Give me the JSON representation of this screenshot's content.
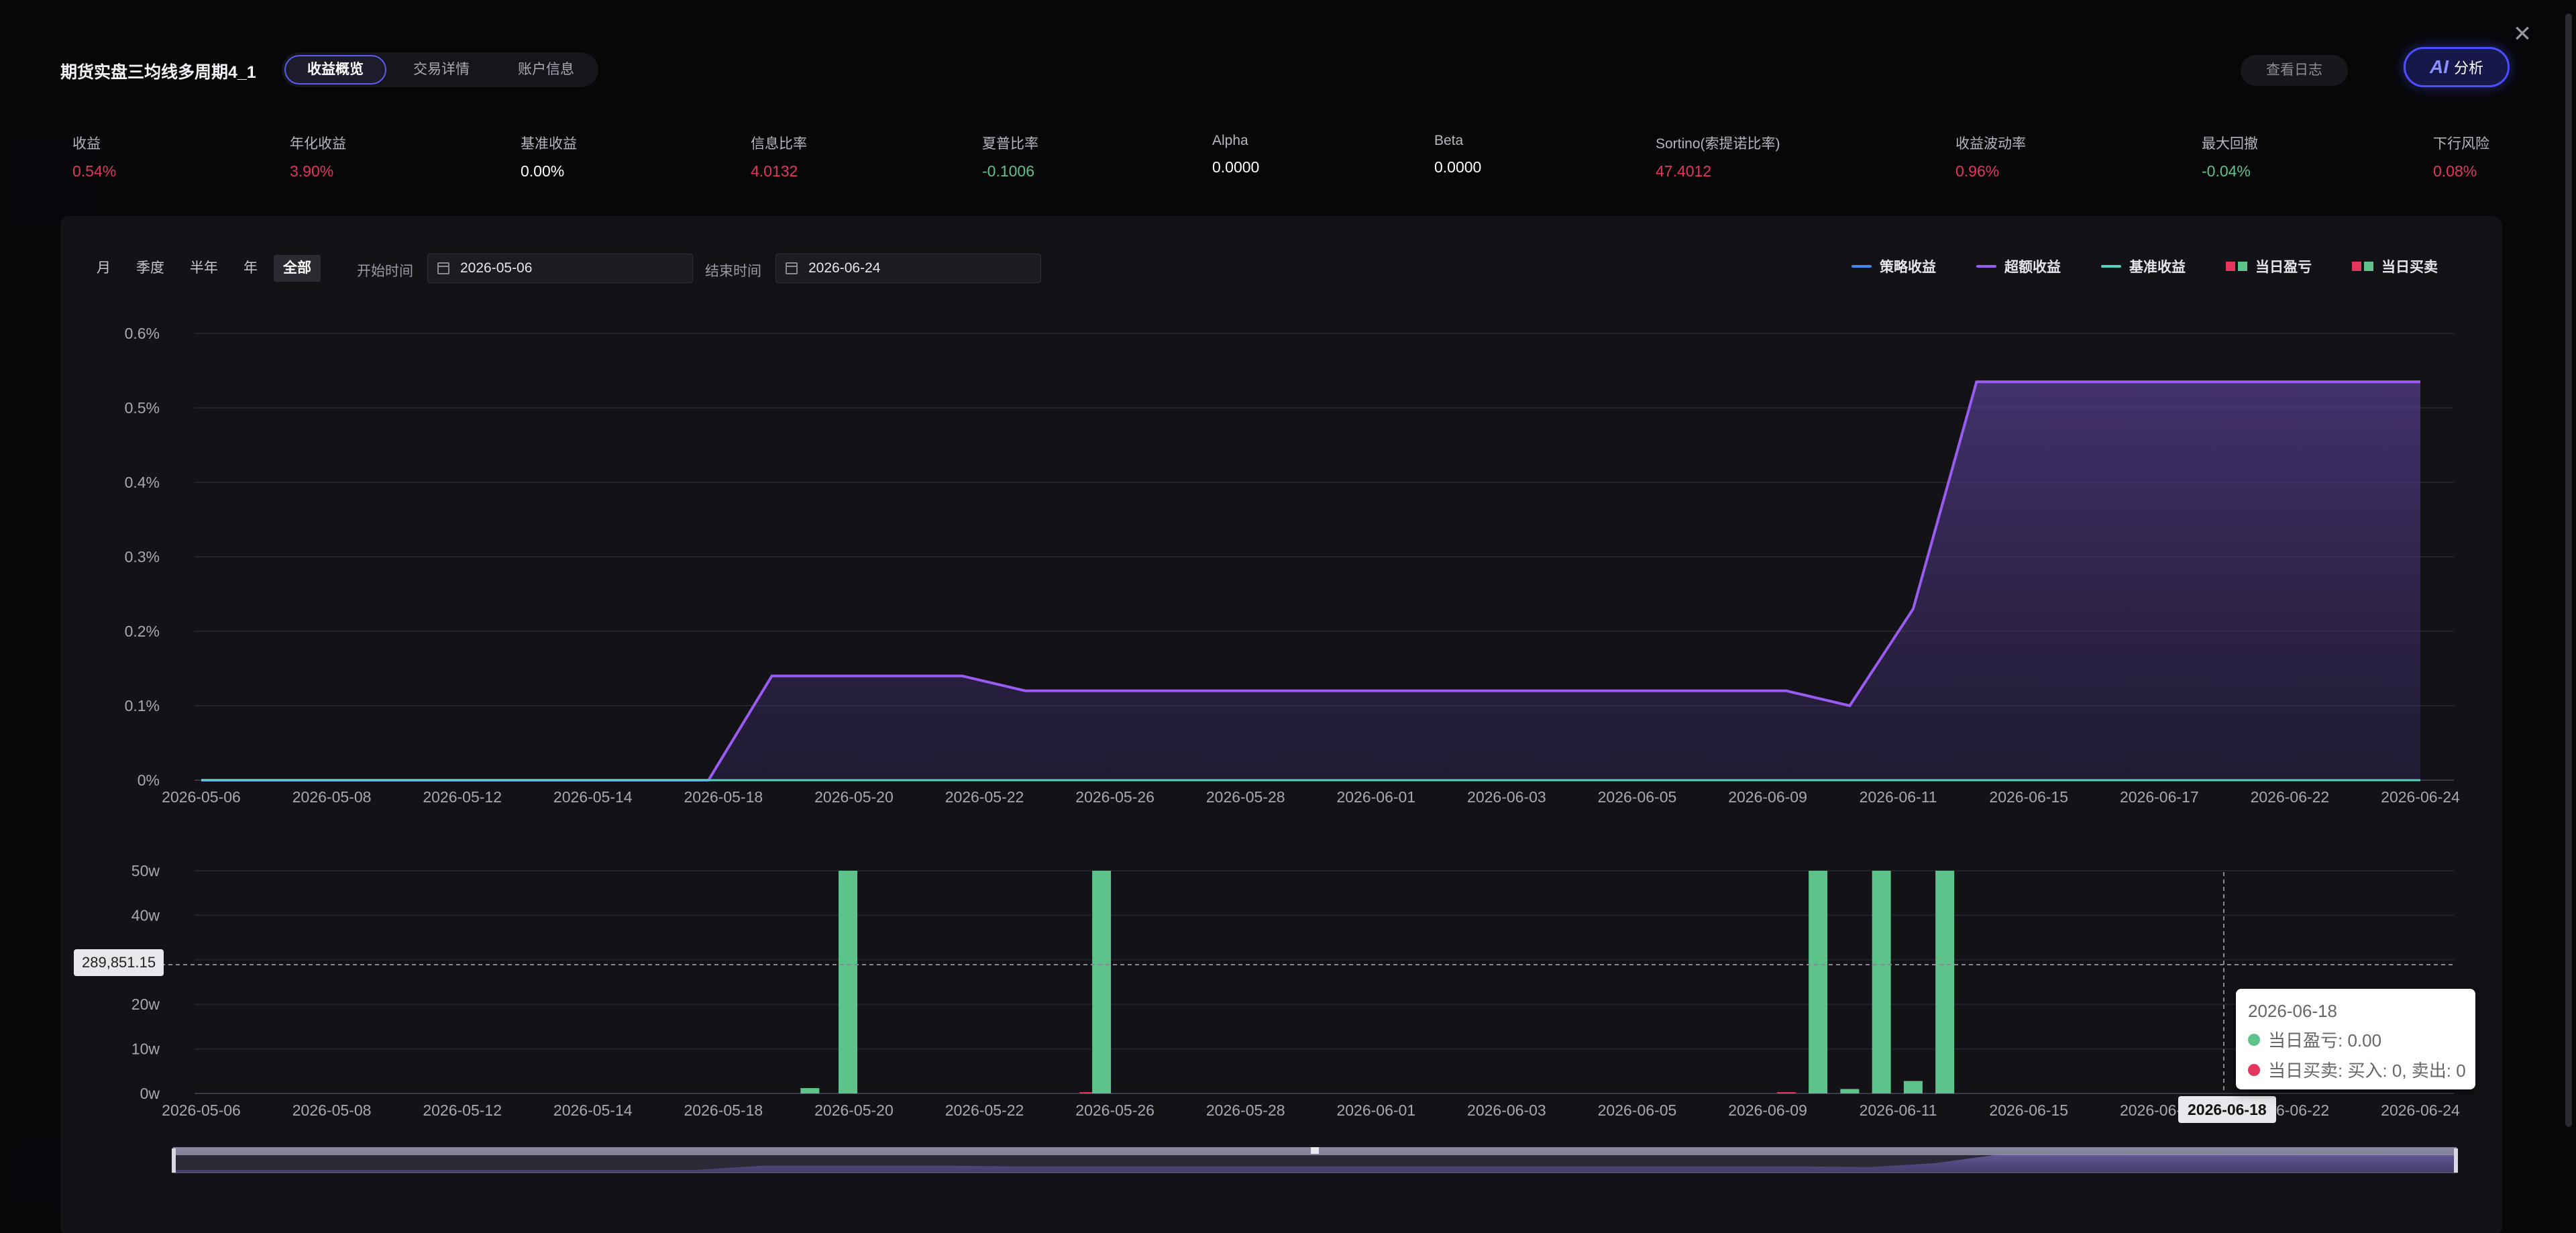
{
  "header": {
    "title": "期货实盘三均线多周期4_1",
    "tabs": [
      {
        "label": "收益概览",
        "active": true
      },
      {
        "label": "交易详情",
        "active": false
      },
      {
        "label": "账户信息",
        "active": false
      }
    ],
    "log_button": "查看日志",
    "ai_button": {
      "icon_text": "AI",
      "label": "分析"
    }
  },
  "metrics": [
    {
      "label": "收益",
      "value": "0.54%",
      "tone": "red"
    },
    {
      "label": "年化收益",
      "value": "3.90%",
      "tone": "red"
    },
    {
      "label": "基准收益",
      "value": "0.00%",
      "tone": "white"
    },
    {
      "label": "信息比率",
      "value": "4.0132",
      "tone": "red"
    },
    {
      "label": "夏普比率",
      "value": "-0.1006",
      "tone": "green"
    },
    {
      "label": "Alpha",
      "value": "0.0000",
      "tone": "white"
    },
    {
      "label": "Beta",
      "value": "0.0000",
      "tone": "white"
    },
    {
      "label": "Sortino(索提诺比率)",
      "value": "47.4012",
      "tone": "red"
    },
    {
      "label": "收益波动率",
      "value": "0.96%",
      "tone": "red"
    },
    {
      "label": "最大回撤",
      "value": "-0.04%",
      "tone": "green"
    },
    {
      "label": "下行风险",
      "value": "0.08%",
      "tone": "red"
    }
  ],
  "controls": {
    "ranges": [
      {
        "label": "月",
        "active": false
      },
      {
        "label": "季度",
        "active": false
      },
      {
        "label": "半年",
        "active": false
      },
      {
        "label": "年",
        "active": false
      },
      {
        "label": "全部",
        "active": true
      }
    ],
    "start_label": "开始时间",
    "start_value": "2026-05-06",
    "end_label": "结束时间",
    "end_value": "2026-06-24"
  },
  "legend": [
    {
      "label": "策略收益",
      "kind": "line",
      "color": "#3d8bf0"
    },
    {
      "label": "超额收益",
      "kind": "line",
      "color": "#9a5cf0"
    },
    {
      "label": "基准收益",
      "kind": "line",
      "color": "#4fd1c1"
    },
    {
      "label": "当日盈亏",
      "kind": "squares",
      "colors": [
        "#e4355c",
        "#5ec38b"
      ]
    },
    {
      "label": "当日买卖",
      "kind": "squares",
      "colors": [
        "#e4355c",
        "#5ec38b"
      ]
    }
  ],
  "chart_data": [
    {
      "type": "area",
      "title": "",
      "xlabel": "",
      "ylabel": "",
      "ylim": [
        0,
        0.6
      ],
      "y_ticks": [
        "0%",
        "0.1%",
        "0.2%",
        "0.3%",
        "0.4%",
        "0.5%",
        "0.6%"
      ],
      "x_ticks": [
        "2026-05-06",
        "2026-05-08",
        "2026-05-12",
        "2026-05-14",
        "2026-05-18",
        "2026-05-20",
        "2026-05-22",
        "2026-05-26",
        "2026-05-28",
        "2026-06-01",
        "2026-06-03",
        "2026-06-05",
        "2026-06-09",
        "2026-06-11",
        "2026-06-15",
        "2026-06-17",
        "2026-06-22",
        "2026-06-24"
      ],
      "series": [
        {
          "name": "超额收益",
          "color": "#9a5cf0",
          "values": [
            0,
            0,
            0,
            0,
            0,
            0,
            0,
            0,
            0,
            0.14,
            0.14,
            0.14,
            0.14,
            0.12,
            0.12,
            0.12,
            0.12,
            0.12,
            0.12,
            0.12,
            0.12,
            0.12,
            0.12,
            0.12,
            0.12,
            0.12,
            0.1,
            0.23,
            0.535,
            0.535,
            0.535,
            0.535,
            0.535,
            0.535,
            0.535,
            0.535
          ]
        },
        {
          "name": "基准收益",
          "color": "#4fd1c1",
          "values": [
            0,
            0,
            0,
            0,
            0,
            0,
            0,
            0,
            0,
            0,
            0,
            0,
            0,
            0,
            0,
            0,
            0,
            0,
            0,
            0,
            0,
            0,
            0,
            0,
            0,
            0,
            0,
            0,
            0,
            0,
            0,
            0,
            0,
            0,
            0,
            0
          ]
        }
      ],
      "grid": true
    },
    {
      "type": "bar",
      "title": "",
      "ylim": [
        0,
        50
      ],
      "y_ticks": [
        "0w",
        "10w",
        "20w",
        "30w",
        "40w",
        "50w"
      ],
      "x_ticks": [
        "2026-05-06",
        "2026-05-08",
        "2026-05-12",
        "2026-05-14",
        "2026-05-18",
        "2026-05-20",
        "2026-05-22",
        "2026-05-26",
        "2026-05-28",
        "2026-06-01",
        "2026-06-03",
        "2026-06-05",
        "2026-06-09",
        "2026-06-11",
        "2026-06-15",
        "2026-06-17",
        "2026-06-22",
        "2026-06-24"
      ],
      "bars": [
        {
          "pos": 9.6,
          "value": 1.2,
          "color": "#5ec38b"
        },
        {
          "pos": 10.2,
          "value": 50,
          "color": "#5ec38b"
        },
        {
          "pos": 14.0,
          "value": 0.3,
          "color": "#e4355c"
        },
        {
          "pos": 14.2,
          "value": 50,
          "color": "#5ec38b"
        },
        {
          "pos": 25.0,
          "value": 0.3,
          "color": "#e4355c"
        },
        {
          "pos": 25.5,
          "value": 50,
          "color": "#5ec38b"
        },
        {
          "pos": 26.0,
          "value": 1.0,
          "color": "#5ec38b"
        },
        {
          "pos": 26.5,
          "value": 50,
          "color": "#5ec38b"
        },
        {
          "pos": 27.0,
          "value": 2.8,
          "color": "#5ec38b"
        },
        {
          "pos": 27.5,
          "value": 50,
          "color": "#5ec38b"
        }
      ],
      "crosshair_value": "289,851.15",
      "crosshair_date": "2026-06-18"
    }
  ],
  "tooltip": {
    "date": "2026-06-18",
    "rows": [
      {
        "text": "当日盈亏: 0.00",
        "color": "#5ec38b"
      },
      {
        "text": "当日买卖: 买入: 0, 卖出: 0",
        "color": "#e4355c"
      }
    ]
  }
}
